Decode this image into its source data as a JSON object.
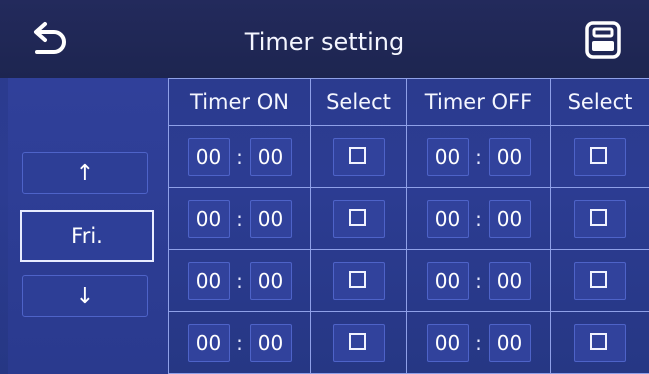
{
  "header": {
    "title": "Timer setting",
    "back_icon": "back-arrow-icon",
    "save_icon": "save-icon"
  },
  "nav": {
    "up_icon": "arrow-up-icon",
    "down_icon": "arrow-down-icon",
    "up_glyph": "↑",
    "down_glyph": "↓",
    "day": "Fri."
  },
  "table": {
    "headers": [
      "Timer ON",
      "Select",
      "Timer OFF",
      "Select"
    ],
    "separator": ":",
    "rows": [
      {
        "on_hour": "00",
        "on_min": "00",
        "on_selected": false,
        "off_hour": "00",
        "off_min": "00",
        "off_selected": false
      },
      {
        "on_hour": "00",
        "on_min": "00",
        "on_selected": false,
        "off_hour": "00",
        "off_min": "00",
        "off_selected": false
      },
      {
        "on_hour": "00",
        "on_min": "00",
        "on_selected": false,
        "off_hour": "00",
        "off_min": "00",
        "off_selected": false
      },
      {
        "on_hour": "00",
        "on_min": "00",
        "on_selected": false,
        "off_hour": "00",
        "off_min": "00",
        "off_selected": false
      }
    ]
  },
  "colors": {
    "background": "#2c3c92",
    "header": "#1d2550",
    "grid_line": "#8fa0e8",
    "text": "#ffffff"
  }
}
